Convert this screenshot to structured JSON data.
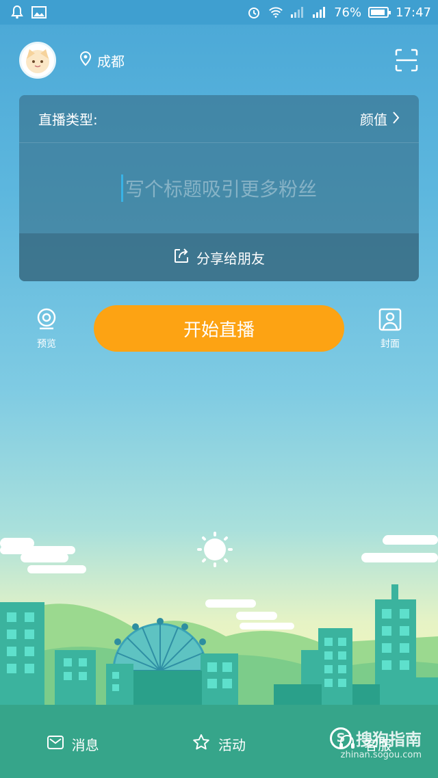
{
  "status_bar": {
    "battery_percent": "76%",
    "time": "17:47",
    "icons": [
      "notification-bell-icon",
      "image-icon",
      "alarm-icon",
      "wifi-icon",
      "signal-icon",
      "signal-icon",
      "battery-icon"
    ]
  },
  "header": {
    "location": "成都",
    "icons": [
      "avatar",
      "location-pin-icon",
      "scan-icon"
    ]
  },
  "live_card": {
    "type_label": "直播类型:",
    "type_value": "颜值",
    "title_placeholder": "写个标题吸引更多粉丝",
    "share_label": "分享给朋友"
  },
  "actions": {
    "preview_label": "预览",
    "start_label": "开始直播",
    "cover_label": "封面"
  },
  "bottom_nav": {
    "items": [
      {
        "label": "消息",
        "icon": "mail-icon"
      },
      {
        "label": "活动",
        "icon": "star-icon"
      },
      {
        "label": "客服",
        "icon": "headset-icon"
      }
    ]
  },
  "watermark": {
    "brand": "搜狗指南",
    "url": "zhinan.sogou.com"
  },
  "colors": {
    "accent_orange": "#fda313",
    "sky_top": "#4aa7d6",
    "caret_blue": "#39b3e6"
  }
}
